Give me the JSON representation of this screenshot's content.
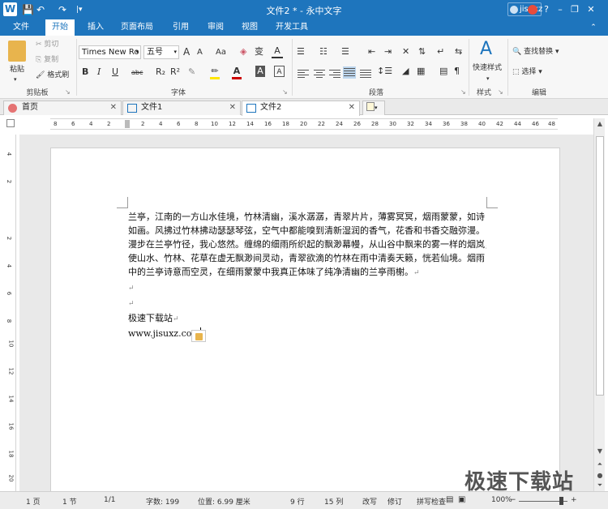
{
  "titlebar": {
    "logo": "W",
    "title": "文件2 * - 永中文字",
    "user": "jisuxz",
    "quick_access": [
      "💾",
      "↶",
      "↷",
      "|▾"
    ]
  },
  "menu": {
    "items": [
      "文件",
      "开始",
      "插入",
      "页面布局",
      "引用",
      "审阅",
      "视图",
      "开发工具"
    ],
    "active": "开始"
  },
  "ribbon": {
    "clipboard": {
      "paste": "粘贴",
      "cut": "剪切",
      "copy": "复制",
      "format_painter": "格式刷",
      "group_label": "剪贴板"
    },
    "font": {
      "font_name": "Times New Ro",
      "font_size": "五号",
      "group_label": "字体",
      "buttons": [
        "A",
        "A",
        "Aa",
        "B",
        "I",
        "U",
        "abc",
        "R₂",
        "R²",
        "A",
        "A",
        "A"
      ]
    },
    "paragraph": {
      "group_label": "段落"
    },
    "style": {
      "quick_style": "快速样式",
      "group_label": "样式"
    },
    "edit": {
      "find_replace": "查找替换",
      "select": "选择",
      "group_label": "编辑"
    }
  },
  "tabs": [
    {
      "label": "首页",
      "active": false
    },
    {
      "label": "文件1",
      "active": false
    },
    {
      "label": "文件2",
      "active": true
    }
  ],
  "ruler": {
    "h_ticks": [
      "8",
      "6",
      "4",
      "2",
      "2",
      "4",
      "6",
      "8",
      "10",
      "12",
      "14",
      "16",
      "18",
      "20",
      "22",
      "24",
      "26",
      "28",
      "30",
      "32",
      "34",
      "36",
      "38",
      "40",
      "42",
      "44",
      "46",
      "48"
    ],
    "v_ticks": [
      "4",
      "2",
      "2",
      "4",
      "6",
      "8",
      "10",
      "12",
      "14",
      "16",
      "18",
      "20"
    ]
  },
  "document": {
    "lines": [
      "兰亭，江南的一方山水佳境，竹林清幽，溪水潺潺，青翠片片，薄雾冥冥，烟雨蒙蒙，如诗",
      "如画。风拂过竹林拂动瑟瑟琴弦，空气中都能嗅到清新湿润的香气，花香和书香交融弥漫。",
      "漫步在兰亭竹径，我心悠然。缠绵的细雨所织起的飘渺幕幔，从山谷中飘来的雾一样的烟岚，",
      "使山水、竹林、花草在虚无飘渺间灵动，青翠欲滴的竹林在雨中清奏天籁，恍若仙境。烟雨",
      "中的兰亭诗意而空灵，在细雨蒙蒙中我真正体味了纯净清幽的兰亭雨榭。"
    ],
    "para_mark": "↵",
    "site_name": "极速下载站",
    "site_url": "www.jisuxz.com"
  },
  "status": {
    "page": "1 页",
    "section": "1 节",
    "page_of": "1/1",
    "word_count": "字数: 199",
    "position": "位置: 6.99 厘米",
    "row": "9 行",
    "col": "15 列",
    "overwrite": "改写",
    "revise": "修订",
    "spellcheck": "拼写检查",
    "zoom": "100%"
  },
  "watermark": "极速下载站"
}
